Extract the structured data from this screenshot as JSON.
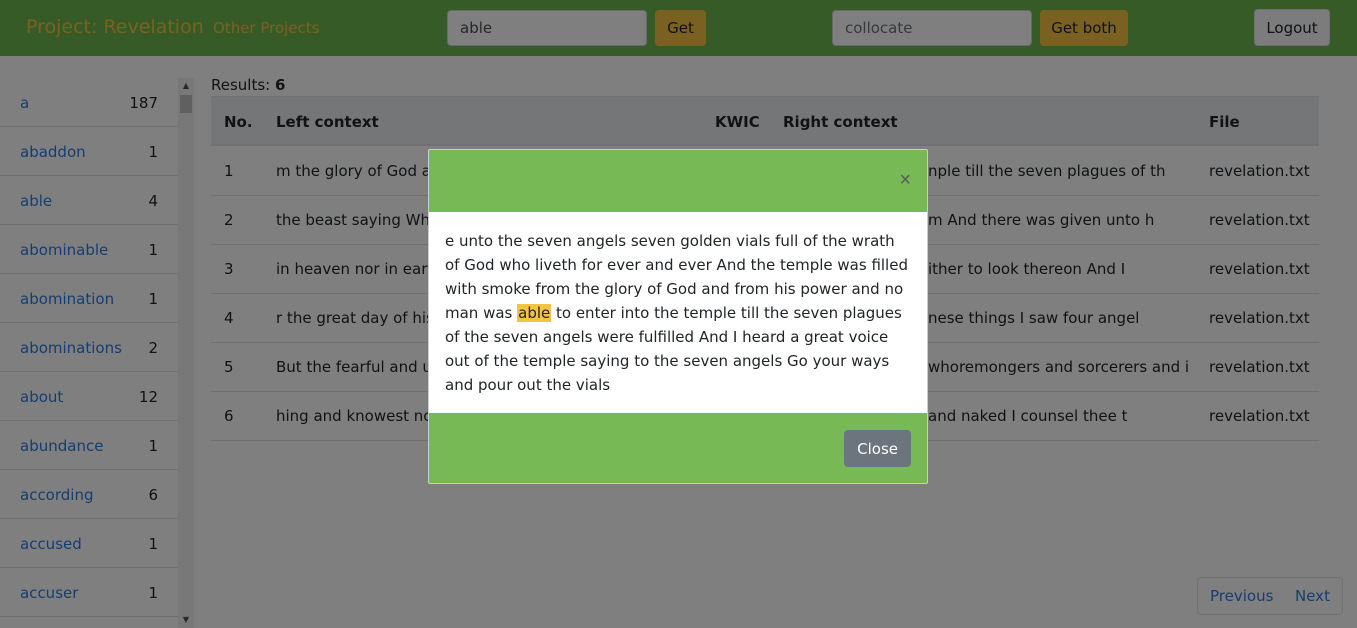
{
  "navbar": {
    "brand": "Project: Revelation",
    "other_projects": "Other Projects",
    "search_value": "able",
    "get_label": "Get",
    "collocate_placeholder": "collocate",
    "get_both_label": "Get both",
    "logout_label": "Logout"
  },
  "sidebar": {
    "items": [
      {
        "word": "a",
        "count": "187"
      },
      {
        "word": "abaddon",
        "count": "1"
      },
      {
        "word": "able",
        "count": "4"
      },
      {
        "word": "abominable",
        "count": "1"
      },
      {
        "word": "abomination",
        "count": "1"
      },
      {
        "word": "abominations",
        "count": "2"
      },
      {
        "word": "about",
        "count": "12"
      },
      {
        "word": "abundance",
        "count": "1"
      },
      {
        "word": "according",
        "count": "6"
      },
      {
        "word": "accused",
        "count": "1"
      },
      {
        "word": "accuser",
        "count": "1"
      }
    ]
  },
  "results": {
    "label": "Results:",
    "count": "6"
  },
  "table": {
    "headers": [
      "No.",
      "Left context",
      "KWIC",
      "Right context",
      "File"
    ],
    "rows": [
      {
        "no": "1",
        "left": "m the glory of God ar",
        "right": "nple till the seven plagues of th",
        "file": "revelation.txt"
      },
      {
        "no": "2",
        "left": "the beast saying Who",
        "right": "m And there was given unto h",
        "file": "revelation.txt"
      },
      {
        "no": "3",
        "left": "in heaven nor in earth",
        "right": "ither to look thereon And I",
        "file": "revelation.txt"
      },
      {
        "no": "4",
        "left": "r the great day of his v",
        "right": "nese things I saw four angel",
        "file": "revelation.txt"
      },
      {
        "no": "5",
        "left": "But the fearful and un",
        "right": "whoremongers and sorcerers and i",
        "file": "revelation.txt"
      },
      {
        "no": "6",
        "left": "hing and knowest not",
        "right": "and naked I counsel thee t",
        "file": "revelation.txt"
      }
    ]
  },
  "pagination": {
    "previous": "Previous",
    "next": "Next"
  },
  "modal": {
    "close_x": "×",
    "text_before": "e unto the seven angels seven golden vials full of the wrath of God who liveth for ever and ever And the temple was filled with smoke from the glory of God and from his power and no man was ",
    "keyword": "able",
    "text_after": " to enter into the temple till the seven plagues of the seven angels were fulfilled And I heard a great voice out of the temple saying to the seven angels Go your ways and pour out the vials",
    "close_label": "Close"
  },
  "colors": {
    "navbar": "#6fb64c",
    "accent": "#f5c344",
    "link": "#2c7be5",
    "modal_green": "#77b955"
  }
}
